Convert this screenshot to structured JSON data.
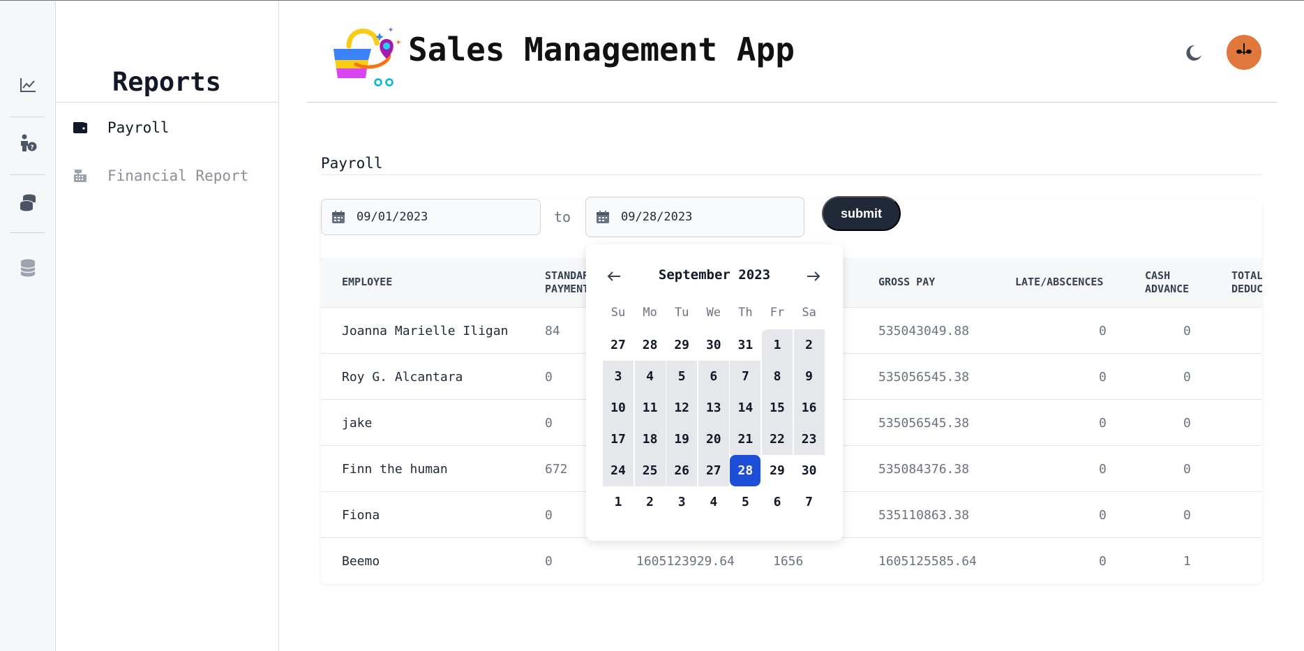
{
  "app": {
    "title": "Sales Management App"
  },
  "rail": {
    "items": [
      {
        "icon": "chart-line-icon"
      },
      {
        "icon": "person-question-icon"
      },
      {
        "icon": "coins-icon"
      },
      {
        "icon": "database-icon"
      }
    ]
  },
  "panel": {
    "title": "Reports",
    "items": [
      {
        "label": "Payroll",
        "icon": "wallet-icon",
        "active": true
      },
      {
        "label": "Financial Report",
        "icon": "cash-register-icon",
        "active": false
      }
    ]
  },
  "content": {
    "section_label": "Payroll",
    "start_date": "09/01/2023",
    "to_label": "to",
    "end_date": "09/28/2023",
    "submit_label": "submit"
  },
  "table": {
    "columns": [
      {
        "line1": "EMPLOYEE",
        "line2": ""
      },
      {
        "line1": "STANDARD",
        "line2": "PAYMENT"
      },
      {
        "line1": "",
        "line2": ""
      },
      {
        "line1": "",
        "line2": ""
      },
      {
        "line1": "GROSS PAY",
        "line2": ""
      },
      {
        "line1": "LATE/ABSCENCES",
        "line2": ""
      },
      {
        "line1": "CASH",
        "line2": "ADVANCE"
      },
      {
        "line1": "TOTAL",
        "line2": "DEDUC"
      }
    ],
    "rows": [
      [
        "Joanna Marielle Iligan",
        "84",
        "",
        "",
        "535043049.88",
        "0",
        "0",
        ""
      ],
      [
        "Roy G. Alcantara",
        "0",
        "",
        "",
        "535056545.38",
        "0",
        "0",
        ""
      ],
      [
        "jake",
        "0",
        "",
        "",
        "535056545.38",
        "0",
        "0",
        ""
      ],
      [
        "Finn the human",
        "672",
        "",
        "",
        "535084376.38",
        "0",
        "0",
        ""
      ],
      [
        "Fiona",
        "0",
        "",
        "",
        "535110863.38",
        "0",
        "0",
        ""
      ],
      [
        "Beemo",
        "0",
        "1605123929.64",
        "1656",
        "1605125585.64",
        "0",
        "1",
        ""
      ]
    ]
  },
  "datepicker": {
    "month_label": "September 2023",
    "prev_icon": "arrow-left-icon",
    "next_icon": "arrow-right-icon",
    "weekdays": [
      "Su",
      "Mo",
      "Tu",
      "We",
      "Th",
      "Fr",
      "Sa"
    ],
    "weeks": [
      [
        "27",
        "28",
        "29",
        "30",
        "31",
        "1",
        "2"
      ],
      [
        "3",
        "4",
        "5",
        "6",
        "7",
        "8",
        "9"
      ],
      [
        "10",
        "11",
        "12",
        "13",
        "14",
        "15",
        "16"
      ],
      [
        "17",
        "18",
        "19",
        "20",
        "21",
        "22",
        "23"
      ],
      [
        "24",
        "25",
        "26",
        "27",
        "28",
        "29",
        "30"
      ],
      [
        "1",
        "2",
        "3",
        "4",
        "5",
        "6",
        "7"
      ]
    ],
    "range_start": "1",
    "selected": "28"
  },
  "colors": {
    "accent": "#1d4ed8",
    "submit": "#1f2937",
    "avatar": "#e0783e",
    "range": "#e5e7eb"
  }
}
